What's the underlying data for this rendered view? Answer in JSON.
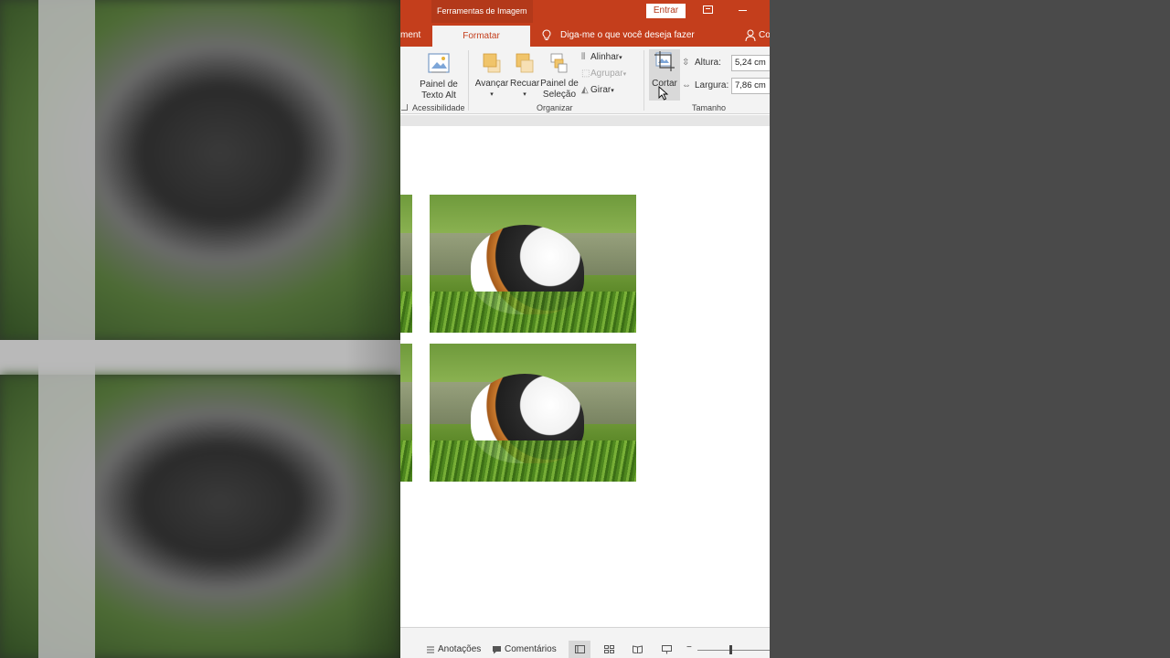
{
  "titlebar": {
    "tool_context": "Ferramentas de Imagem",
    "signin_label": "Entrar"
  },
  "tabs": {
    "left_partial": "ment",
    "active": "Formatar",
    "tell_me": "Diga-me o que você deseja fazer",
    "share_partial": "Co"
  },
  "ribbon": {
    "alt_text_line1": "Painel de",
    "alt_text_line2": "Texto Alt",
    "accessibility_group": "Acessibilidade",
    "bring_forward": "Avançar",
    "send_backward": "Recuar",
    "selection_line1": "Painel de",
    "selection_line2": "Seleção",
    "align": "Alinhar",
    "group": "Agrupar",
    "rotate": "Girar",
    "arrange_group": "Organizar",
    "crop": "Cortar",
    "height_label": "Altura:",
    "height_value": "5,24 cm",
    "width_label": "Largura:",
    "width_value": "7,86 cm",
    "size_group": "Tamanho"
  },
  "statusbar": {
    "notes": "Anotações",
    "comments": "Comentários"
  },
  "colors": {
    "accent": "#c43e1c",
    "ribbon_bg": "#f3f3f3"
  }
}
